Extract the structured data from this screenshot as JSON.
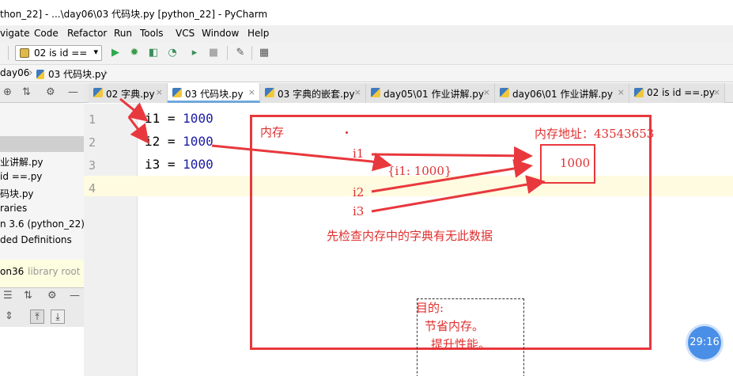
{
  "window": {
    "title": "thon_22] - ...\\day06\\03 代码块.py [python_22] - PyCharm"
  },
  "menu": [
    "vigate",
    "Code",
    "Refactor",
    "Run",
    "Tools",
    "VCS",
    "Window",
    "Help"
  ],
  "toolbar": {
    "run_config": "02 is id =="
  },
  "breadcrumb": [
    "day06",
    "03 代码块.py"
  ],
  "tabs": [
    {
      "label": "02 字典.py",
      "active": false
    },
    {
      "label": "03 代码块.py",
      "active": true
    },
    {
      "label": "03 字典的嵌套.py",
      "active": false
    },
    {
      "label": "day05\\01 作业讲解.py",
      "active": false
    },
    {
      "label": "day06\\01 作业讲解.py",
      "active": false
    },
    {
      "label": "02 is id ==.py",
      "active": false
    }
  ],
  "project": {
    "items": [
      "业讲解.py",
      "id ==.py",
      "码块.py",
      "raries",
      "n 3.6 (python_22) >",
      "ded Definitions"
    ],
    "root": {
      "name": "on36",
      "tag": "library root"
    }
  },
  "editor": {
    "line_numbers": [
      "1",
      "2",
      "3",
      "4"
    ],
    "lines": [
      {
        "var": "i1",
        "op": " = ",
        "val": "1000"
      },
      {
        "var": "i2",
        "op": " = ",
        "val": "1000"
      },
      {
        "var": "i3",
        "op": " = ",
        "val": "1000"
      }
    ]
  },
  "annotation": {
    "memory": "内存",
    "address": "内存地址：43543653",
    "value": "1000",
    "i1": "i1",
    "dict": "{i1: 1000}",
    "i2": "i2",
    "i3": "i3",
    "check": "先检查内存中的字典有无此数据",
    "purpose": "目的:",
    "save": "节省内存。",
    "perf": "提升性能。"
  },
  "timer": "29:16",
  "colors": {
    "annotation_red": "#e8383d",
    "number_blue": "#1a1aa6",
    "timer_blue": "#4a8fe7"
  }
}
